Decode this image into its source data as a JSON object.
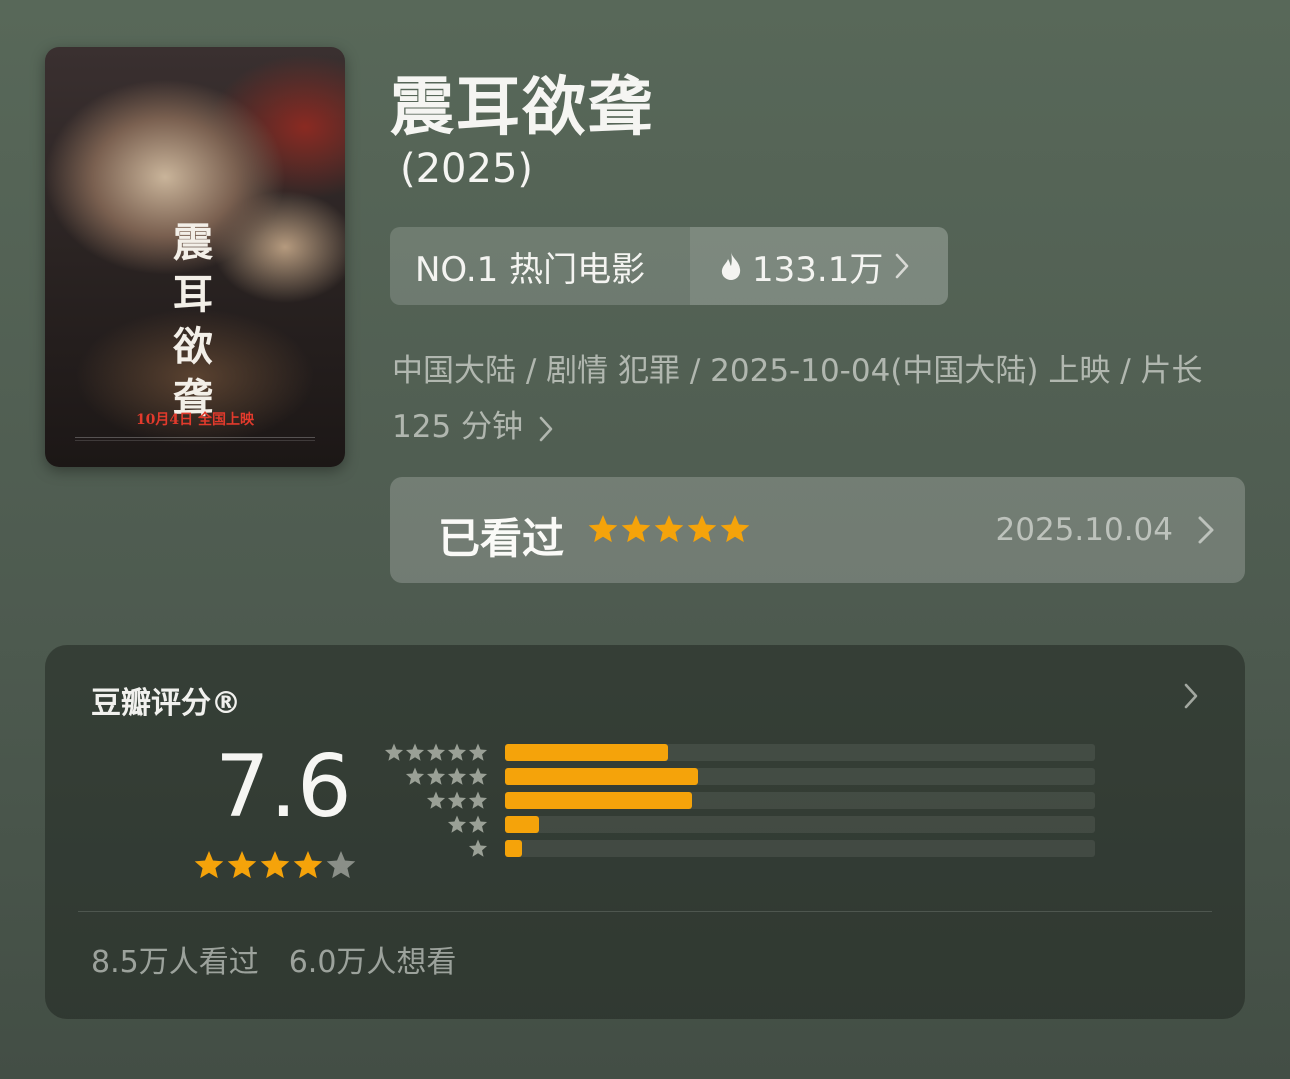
{
  "movie": {
    "title": "震耳欲聋",
    "year": "(2025)",
    "poster": {
      "title_lines": [
        "震",
        "耳",
        "欲",
        "聋"
      ],
      "release_text": "10月4日 全国上映"
    }
  },
  "rank_badge": {
    "label": "NO.1 热门电影",
    "heat": "133.1万",
    "fire_icon": "fire-icon",
    "chevron_icon": "chevron-right-icon"
  },
  "meta": {
    "line1": "中国大陆 / 剧情 犯罪 / 2025-10-04(中国大陆) 上映 / 片长",
    "line2": "125 分钟"
  },
  "watched": {
    "label": "已看过",
    "user_stars": 5,
    "date": "2025.10.04"
  },
  "rating": {
    "heading": "豆瓣评分®",
    "score": "7.6",
    "stars": 4,
    "distribution": [
      {
        "stars": 5,
        "fraction": 0.277
      },
      {
        "stars": 4,
        "fraction": 0.327
      },
      {
        "stars": 3,
        "fraction": 0.317
      },
      {
        "stars": 2,
        "fraction": 0.058
      },
      {
        "stars": 1,
        "fraction": 0.029
      }
    ],
    "watched_count": "8.5万人看过",
    "wish_count": "6.0万人想看"
  },
  "colors": {
    "accent_orange": "#f5a30a",
    "star_grey": "#8a8f88",
    "star_small_grey": "#9aa096"
  }
}
